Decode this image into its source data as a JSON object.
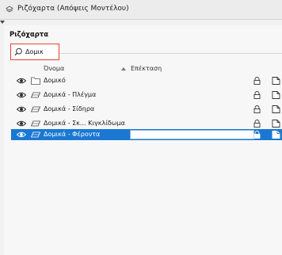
{
  "window": {
    "title": "Ριζόχαρτα (Απόψεις Μοντέλου)",
    "title_icon": "layers-icon"
  },
  "panel": {
    "title": "Ριζόχαρτα"
  },
  "search": {
    "value": "Δομικ",
    "icon": "search-icon"
  },
  "columns": {
    "name": "Όνομα",
    "extension": "Επέκταση",
    "sort": "ascending"
  },
  "accent_color": "#e8412c",
  "selection_color": "#1a78d2",
  "rows": [
    {
      "label": "Δομικό",
      "type": "folder-icon",
      "selected": false
    },
    {
      "label": "Δομικά - Πλέγμα",
      "type": "layer-icon",
      "selected": false
    },
    {
      "label": "Δομικά - Σίδηρα",
      "type": "layer-icon",
      "selected": false
    },
    {
      "label": "Δομικά - Σκ... Κιγκλίδωμα",
      "type": "layer-icon",
      "selected": false
    },
    {
      "label": "Δομικά - Φέροντα",
      "type": "layer-icon",
      "selected": true
    }
  ]
}
